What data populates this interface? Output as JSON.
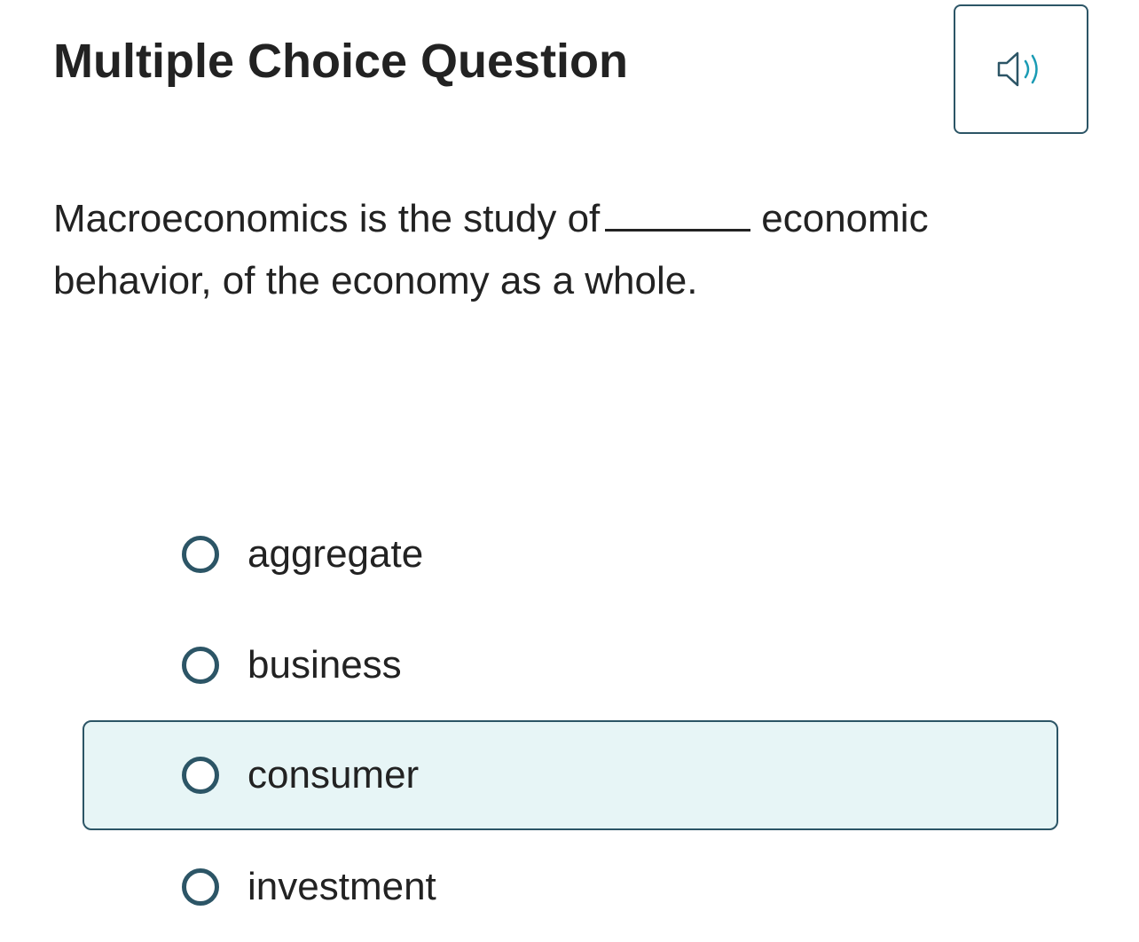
{
  "header": {
    "title": "Multiple Choice Question",
    "audio_icon": "speaker-icon"
  },
  "question": {
    "text_before": "Macroeconomics is the study of",
    "text_after": "economic behavior, of the economy as a whole."
  },
  "options": [
    {
      "label": "aggregate",
      "selected": false
    },
    {
      "label": "business",
      "selected": false
    },
    {
      "label": "consumer",
      "selected": false,
      "hovered": true
    },
    {
      "label": "investment",
      "selected": false
    }
  ],
  "colors": {
    "accent": "#2c5566",
    "hover_background": "#e7f5f6",
    "speaker_waves": "#1a9bb4",
    "text": "#222222"
  }
}
